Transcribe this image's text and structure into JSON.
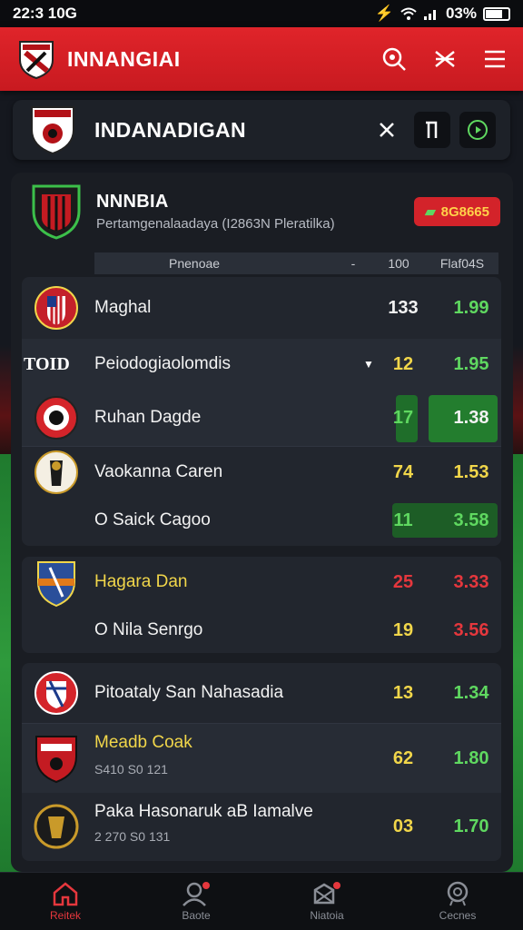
{
  "status": {
    "time": "22:3 10G",
    "battery": "03%"
  },
  "appbar": {
    "title": "INNANGIAI"
  },
  "search": {
    "title": "INDANADIGAN"
  },
  "league": {
    "name": "NNNBIA",
    "subtitle": "Pertamgenalaadaya (I2863N Pleratilka)",
    "pill": "8G8665"
  },
  "columns": {
    "a": "Pnenoae",
    "b": "-",
    "c": "100",
    "d": "Flaf04S"
  },
  "groups": [
    {
      "rows": [
        {
          "name": "Maghal",
          "v1": "133",
          "v2": "1.99"
        },
        {
          "tag": "TOID",
          "name": "Peiodogiaolomdis",
          "v1": "12",
          "v2": "1.95"
        },
        {
          "name": "Ruhan Dagde",
          "v1": "17",
          "v2": "1.38"
        },
        {
          "name": "Vaokanna Caren",
          "v1": "74",
          "v2": "1.53"
        },
        {
          "name": "O Saick Cagoo",
          "v1": "11",
          "v2": "3.58"
        }
      ]
    },
    {
      "rows": [
        {
          "name": "Hagara Dan",
          "v1": "25",
          "v2": "3.33"
        },
        {
          "name": "O Nila Senrgo",
          "v1": "19",
          "v2": "3.56"
        }
      ]
    },
    {
      "rows": [
        {
          "name": "Pitoataly San Nahasadia",
          "v1": "13",
          "v2": "1.34"
        },
        {
          "name": "Meadb Coak",
          "sub": "S410 S0 121",
          "v1": "62",
          "v2": "1.80"
        },
        {
          "name": "Paka Hasonaruk aB Iamalve",
          "sub": "2 270 S0 131",
          "v1": "03",
          "v2": "1.70"
        }
      ]
    }
  ],
  "tabs": [
    {
      "label": "Reitek"
    },
    {
      "label": "Baote"
    },
    {
      "label": "Niatoia"
    },
    {
      "label": "Cecnes"
    }
  ],
  "colors": {
    "accent": "#d3232a",
    "odds_green": "#5fd860",
    "odds_yellow": "#f1d64a"
  }
}
